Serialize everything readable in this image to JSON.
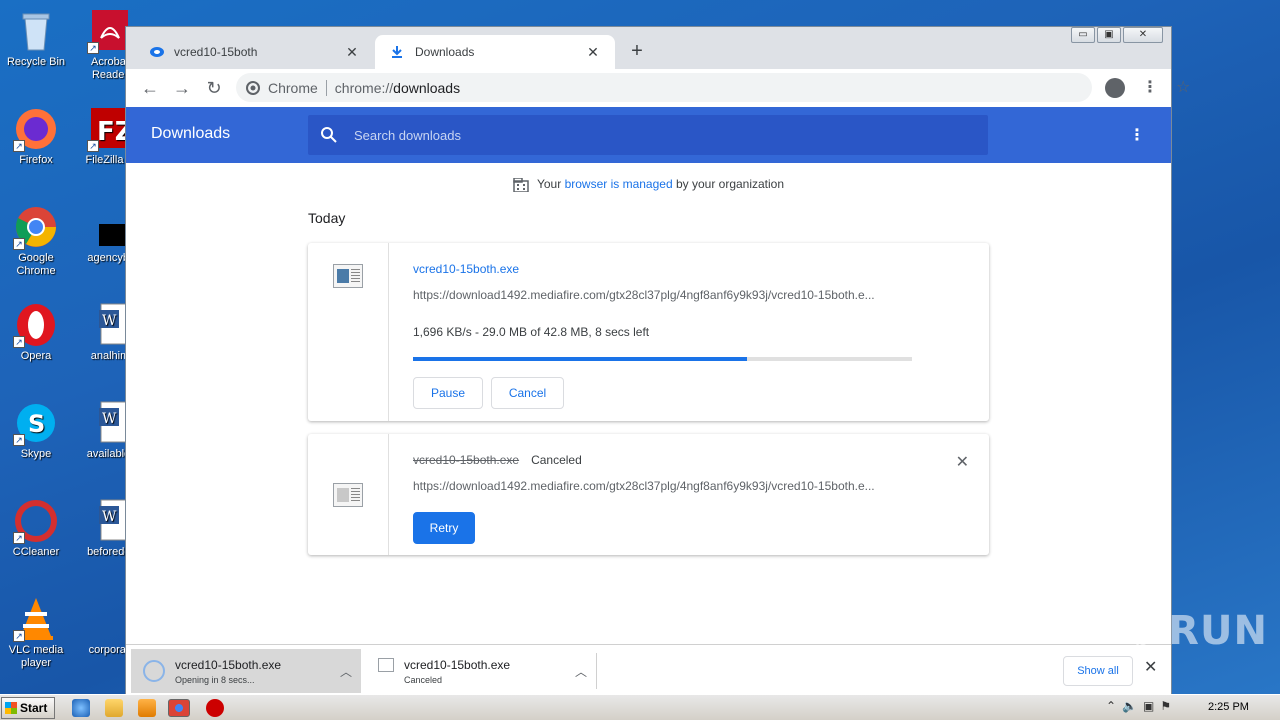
{
  "desktop": {
    "icons": [
      {
        "label": "Recycle Bin"
      },
      {
        "label": "Acrobat Reader"
      },
      {
        "label": "Firefox"
      },
      {
        "label": "FileZilla C"
      },
      {
        "label": "Google Chrome"
      },
      {
        "label": "agencybr"
      },
      {
        "label": "Opera"
      },
      {
        "label": "analhim"
      },
      {
        "label": "Skype"
      },
      {
        "label": "availablet"
      },
      {
        "label": "CCleaner"
      },
      {
        "label": "beforedoi"
      },
      {
        "label": "VLC media player"
      },
      {
        "label": "corporati"
      }
    ]
  },
  "browser": {
    "tabs": [
      {
        "title": "vcred10-15both",
        "close": "✕"
      },
      {
        "title": "Downloads",
        "close": "✕"
      }
    ],
    "new_tab": "+",
    "window_controls": {
      "minimize": "▭",
      "maximize": "▣",
      "close": "✕"
    },
    "omnibox": {
      "site": "Chrome",
      "scheme": "chrome://",
      "host": "downloads"
    }
  },
  "downloads_page": {
    "title": "Downloads",
    "search_placeholder": "Search downloads",
    "managed": {
      "prefix": "Your ",
      "link": "browser is managed",
      "suffix": " by your organization"
    },
    "section": "Today",
    "items": [
      {
        "file_name": "vcred10-15both.exe",
        "url": "https://download1492.mediafire.com/gtx28cl37plg/4ngf8anf6y9k93j/vcred10-15both.e...",
        "progress_text": "1,696 KB/s - 29.0 MB of 42.8 MB, 8 secs left",
        "progress_fraction": 0.67,
        "pause_label": "Pause",
        "cancel_label": "Cancel"
      },
      {
        "file_name": "vcred10-15both.exe",
        "status": "Canceled",
        "url": "https://download1492.mediafire.com/gtx28cl37plg/4ngf8anf6y9k93j/vcred10-15both.e...",
        "retry_label": "Retry"
      }
    ]
  },
  "shelf": {
    "items": [
      {
        "name": "vcred10-15both.exe",
        "sub": "Opening in 8 secs..."
      },
      {
        "name": "vcred10-15both.exe",
        "sub": "Canceled"
      }
    ],
    "show_all": "Show all"
  },
  "watermark": "ANY▷RUN",
  "taskbar": {
    "start": "Start",
    "clock": "2:25 PM"
  },
  "colors": {
    "header_blue": "#3367d6",
    "link_blue": "#1a73e8"
  }
}
